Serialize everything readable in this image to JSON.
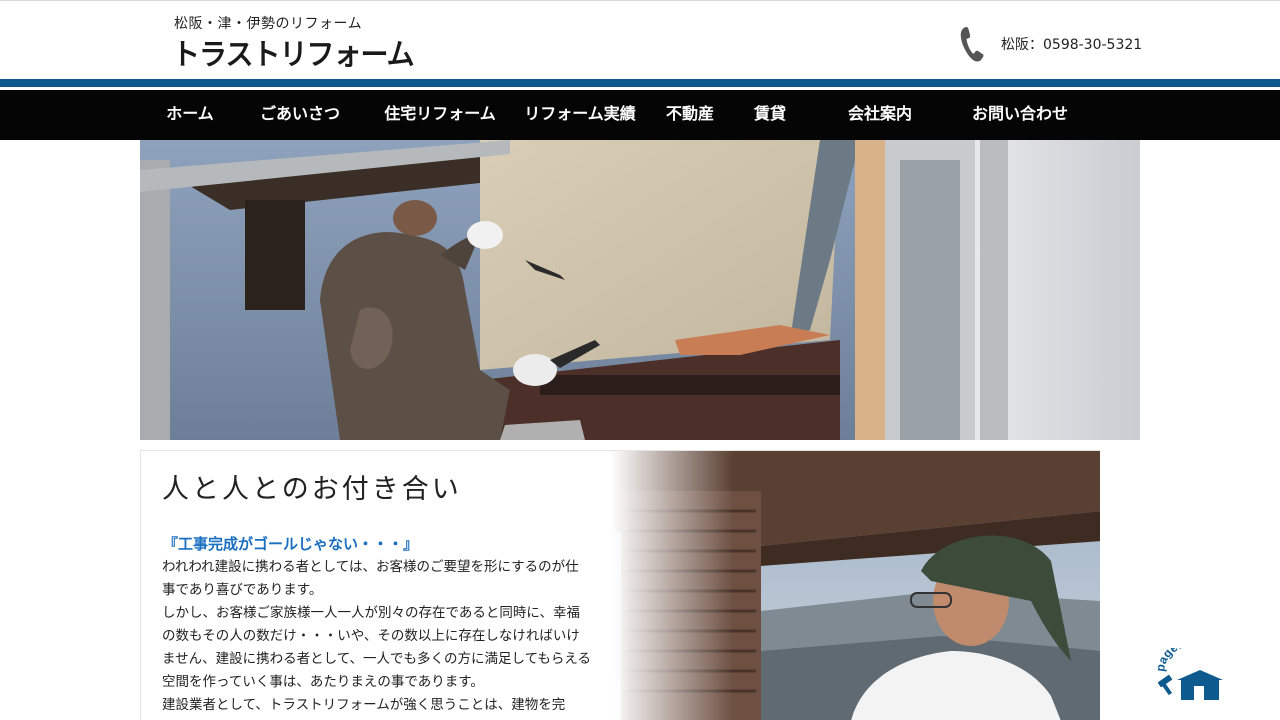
{
  "header": {
    "tagline": "松阪・津・伊勢のリフォーム",
    "logo": "トラストリフォーム",
    "phone": "松阪：0598-30-5321",
    "phone_icon": "phone-icon"
  },
  "nav": {
    "items": [
      {
        "label": "ホーム"
      },
      {
        "label": "ごあいさつ"
      },
      {
        "label": "住宅リフォーム"
      },
      {
        "label": "リフォーム実績"
      },
      {
        "label": "不動産"
      },
      {
        "label": "賃貸"
      },
      {
        "label": "会社案内"
      },
      {
        "label": "お問い合わせ"
      }
    ]
  },
  "main": {
    "heading": "人と人とのお付き合い",
    "subheading": "『工事完成がゴールじゃない・・・』",
    "paragraphs": [
      "われわれ建設に携わる者としては、お客様のご要望を形にするのが仕事であり喜びであります。",
      "しかし、お客様ご家族様一人一人が別々の存在であると同時に、幸福の数もその人の数だけ・・・いや、その数以上に存在しなければいけません、建設に携わる者として、一人でも多くの方に満足してもらえる空間を作っていく事は、あたりまえの事であります。",
      "建設業者として、トラストリフォームが強く思うことは、建物を完"
    ]
  },
  "pagetop": {
    "label": "pagetop"
  },
  "colors": {
    "accent_blue": "#0c5a8e",
    "nav_bg": "#050505",
    "subheading_blue": "#1a6fc1"
  }
}
